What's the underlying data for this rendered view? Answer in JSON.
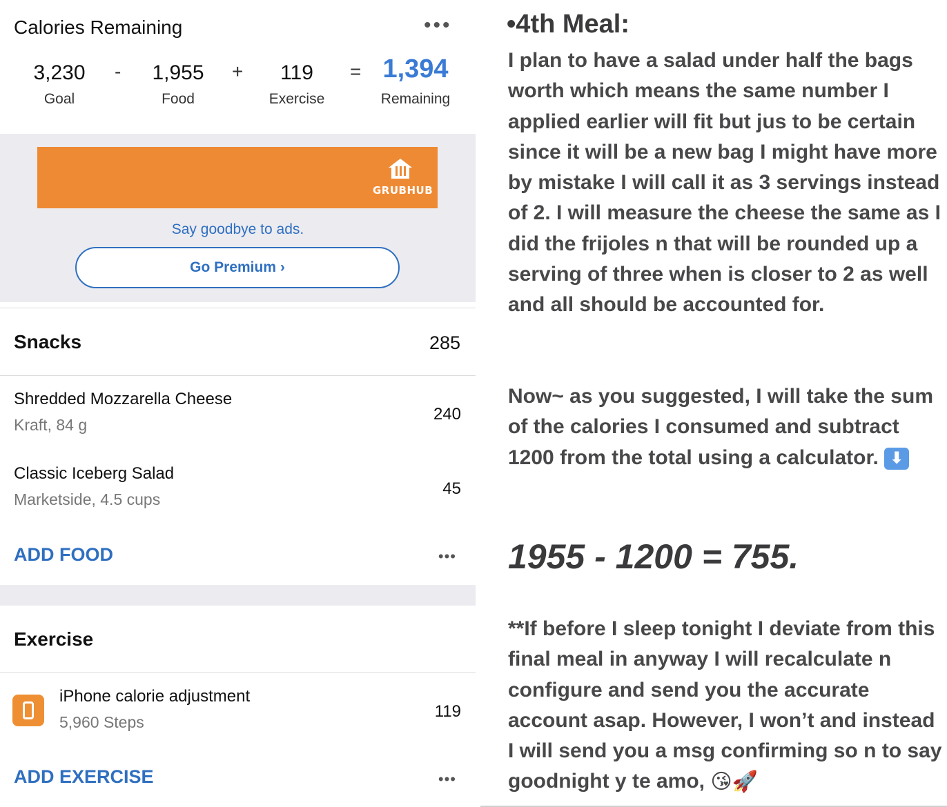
{
  "left": {
    "header": {
      "title": "Calories Remaining",
      "more": "•••"
    },
    "equation": {
      "goal_value": "3,230",
      "goal_label": "Goal",
      "minus": "-",
      "food_value": "1,955",
      "food_label": "Food",
      "plus": "+",
      "exercise_value": "119",
      "exercise_label": "Exercise",
      "equals": "=",
      "remaining_value": "1,394",
      "remaining_label": "Remaining"
    },
    "ad": {
      "brand": "GRUBHUB",
      "say_goodbye": "Say goodbye to ads.",
      "go_premium": "Go Premium ›"
    },
    "snacks": {
      "title": "Snacks",
      "total": "285",
      "items": [
        {
          "name": "Shredded Mozzarella Cheese",
          "detail": "Kraft, 84 g",
          "calories": "240"
        },
        {
          "name": "Classic Iceberg Salad",
          "detail": "Marketside, 4.5 cups",
          "calories": "45"
        }
      ],
      "add_label": "ADD FOOD",
      "more": "•••"
    },
    "exercise": {
      "title": "Exercise",
      "items": [
        {
          "name": "iPhone calorie adjustment",
          "detail": "5,960 Steps",
          "calories": "119"
        }
      ],
      "add_label": "ADD EXERCISE",
      "more": "•••"
    },
    "colors": {
      "accent_blue": "#2f6fc0",
      "remaining_blue": "#3a7bd5",
      "grubhub_orange": "#ef8a34"
    }
  },
  "right": {
    "title": "•4th Meal:",
    "para1": "I plan to have a salad under half the bags worth which means the same number I applied earlier will fit but jus to be certain since it will be a new bag I might have more by mistake I will call it as 3 servings instead of 2. I will measure the cheese the same as I did the frijoles n that will be rounded up a serving of three when is closer to 2 as well and all should be accounted for.",
    "para2": "Now~ as you suggested, I will take the sum of the calories I consumed and subtract 1200 from the total using a calculator.",
    "para2_emoji": "⬇",
    "equation": "1955 - 1200 = 755.",
    "para3": "**If before I sleep tonight I deviate from this final meal in anyway I will recalculate n configure and send you the accurate account asap. However, I won’t and instead I will send you a msg confirming so n to say goodnight y te amo,",
    "para3_emoji_kiss": "😘",
    "para3_emoji_rocket": "🚀"
  }
}
